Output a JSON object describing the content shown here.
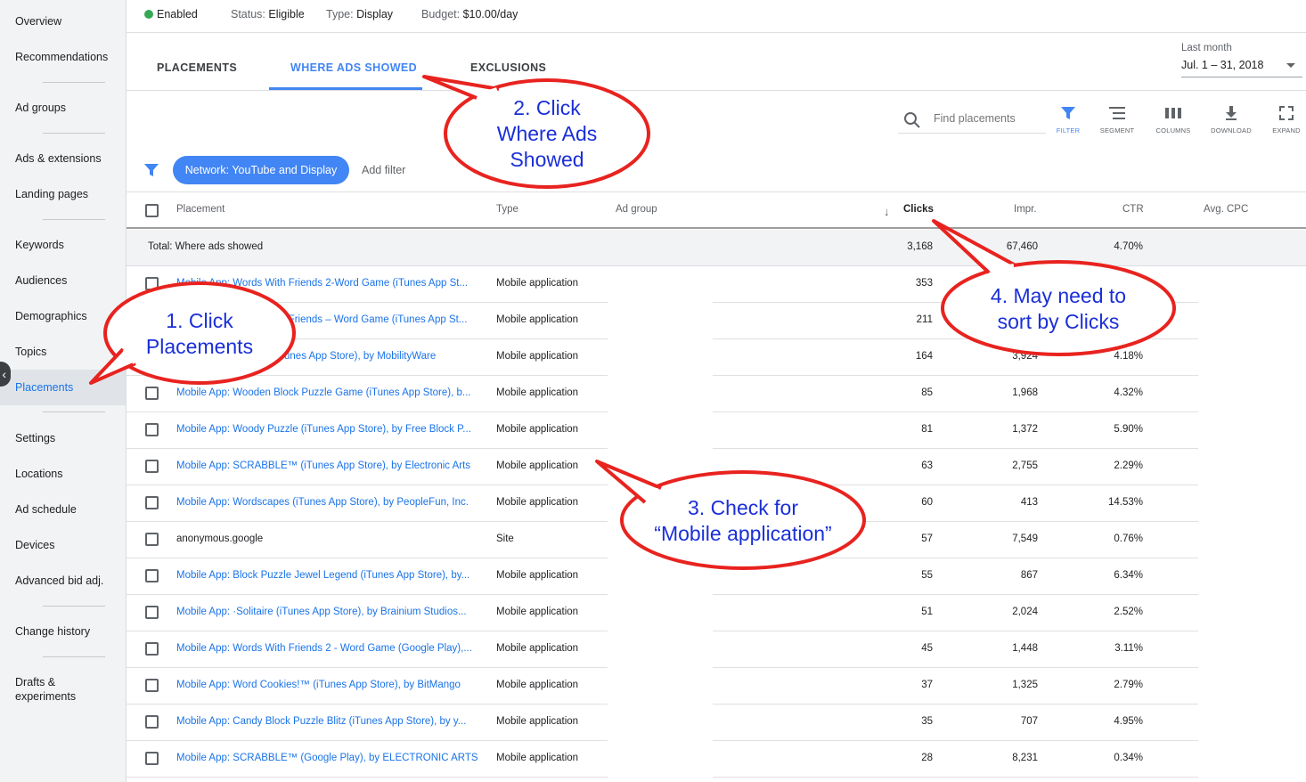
{
  "sidebar": {
    "items": [
      {
        "label": "Overview"
      },
      {
        "label": "Recommendations"
      },
      {
        "label": "Ad groups"
      },
      {
        "label": "Ads & extensions"
      },
      {
        "label": "Landing pages"
      },
      {
        "label": "Keywords"
      },
      {
        "label": "Audiences"
      },
      {
        "label": "Demographics"
      },
      {
        "label": "Topics"
      },
      {
        "label": "Placements"
      },
      {
        "label": "Settings"
      },
      {
        "label": "Locations"
      },
      {
        "label": "Ad schedule"
      },
      {
        "label": "Devices"
      },
      {
        "label": "Advanced bid adj."
      },
      {
        "label": "Change history"
      },
      {
        "label": "Drafts &"
      },
      {
        "label": "experiments"
      }
    ],
    "active": "Placements"
  },
  "status": {
    "state": "Enabled",
    "status_label": "Status:",
    "status_value": "Eligible",
    "type_label": "Type:",
    "type_value": "Display",
    "budget_label": "Budget:",
    "budget_value": "$10.00/day"
  },
  "tabs": [
    {
      "label": "PLACEMENTS"
    },
    {
      "label": "WHERE ADS SHOWED"
    },
    {
      "label": "EXCLUSIONS"
    }
  ],
  "date_range": {
    "label": "Last month",
    "value": "Jul. 1 – 31, 2018"
  },
  "toolbar": {
    "search_placeholder": "Find placements",
    "filter": "FILTER",
    "segment": "SEGMENT",
    "columns": "COLUMNS",
    "download": "DOWNLOAD",
    "expand": "EXPAND"
  },
  "filter_chip": "Network: YouTube and Display",
  "add_filter": "Add filter",
  "table": {
    "headers": {
      "placement": "Placement",
      "type": "Type",
      "ad_group": "Ad group",
      "clicks": "Clicks",
      "impr": "Impr.",
      "ctr": "CTR",
      "avg_cpc": "Avg. CPC"
    },
    "total": {
      "label": "Total: Where ads showed",
      "clicks": "3,168",
      "impr": "67,460",
      "ctr": "4.70%"
    },
    "rows": [
      {
        "placement": "Mobile App: Words With Friends 2-Word Game (iTunes App St...",
        "type": "Mobile application",
        "clicks": "353",
        "impr": "",
        "ctr": "",
        "link": true
      },
      {
        "placement": "Mobile App: Words With Friends – Word Game (iTunes App St...",
        "type": "Mobile application",
        "clicks": "211",
        "impr": "",
        "ctr": "",
        "link": true
      },
      {
        "placement": "Mobile App: Solitaire (iTunes App Store), by MobilityWare",
        "type": "Mobile application",
        "clicks": "164",
        "impr": "3,924",
        "ctr": "4.18%",
        "link": true
      },
      {
        "placement": "Mobile App: Wooden Block Puzzle Game (iTunes App Store), b...",
        "type": "Mobile application",
        "clicks": "85",
        "impr": "1,968",
        "ctr": "4.32%",
        "link": true
      },
      {
        "placement": "Mobile App: Woody Puzzle (iTunes App Store), by Free Block P...",
        "type": "Mobile application",
        "clicks": "81",
        "impr": "1,372",
        "ctr": "5.90%",
        "link": true
      },
      {
        "placement": "Mobile App: SCRABBLE™ (iTunes App Store), by Electronic Arts",
        "type": "Mobile application",
        "clicks": "63",
        "impr": "2,755",
        "ctr": "2.29%",
        "link": true
      },
      {
        "placement": "Mobile App: Wordscapes (iTunes App Store), by PeopleFun, Inc.",
        "type": "Mobile application",
        "clicks": "60",
        "impr": "413",
        "ctr": "14.53%",
        "link": true
      },
      {
        "placement": "anonymous.google",
        "type": "Site",
        "clicks": "57",
        "impr": "7,549",
        "ctr": "0.76%",
        "link": false
      },
      {
        "placement": "Mobile App: Block Puzzle Jewel Legend (iTunes App Store), by...",
        "type": "Mobile application",
        "clicks": "55",
        "impr": "867",
        "ctr": "6.34%",
        "link": true
      },
      {
        "placement": "Mobile App: ·Solitaire (iTunes App Store), by Brainium Studios...",
        "type": "Mobile application",
        "clicks": "51",
        "impr": "2,024",
        "ctr": "2.52%",
        "link": true
      },
      {
        "placement": "Mobile App: Words With Friends 2 - Word Game (Google Play),...",
        "type": "Mobile application",
        "clicks": "45",
        "impr": "1,448",
        "ctr": "3.11%",
        "link": true
      },
      {
        "placement": "Mobile App: Word Cookies!™ (iTunes App Store), by BitMango",
        "type": "Mobile application",
        "clicks": "37",
        "impr": "1,325",
        "ctr": "2.79%",
        "link": true
      },
      {
        "placement": "Mobile App: Candy Block Puzzle Blitz (iTunes App Store), by y...",
        "type": "Mobile application",
        "clicks": "35",
        "impr": "707",
        "ctr": "4.95%",
        "link": true
      },
      {
        "placement": "Mobile App: SCRABBLE™ (Google Play), by ELECTRONIC ARTS",
        "type": "Mobile application",
        "clicks": "28",
        "impr": "8,231",
        "ctr": "0.34%",
        "link": true
      }
    ]
  },
  "annotations": [
    {
      "line1": "1. Click",
      "line2": "Placements",
      "line3": ""
    },
    {
      "line1": "2. Click",
      "line2": "Where Ads",
      "line3": "Showed"
    },
    {
      "line1": "3. Check for",
      "line2": "“Mobile application”",
      "line3": ""
    },
    {
      "line1": "4. May need to",
      "line2": "sort by Clicks",
      "line3": ""
    }
  ],
  "colors": {
    "accent": "#4285f4",
    "link": "#1a73e8",
    "enabled": "#34a853",
    "callout_stroke": "#e8231f",
    "callout_text": "#1a2fd8"
  }
}
